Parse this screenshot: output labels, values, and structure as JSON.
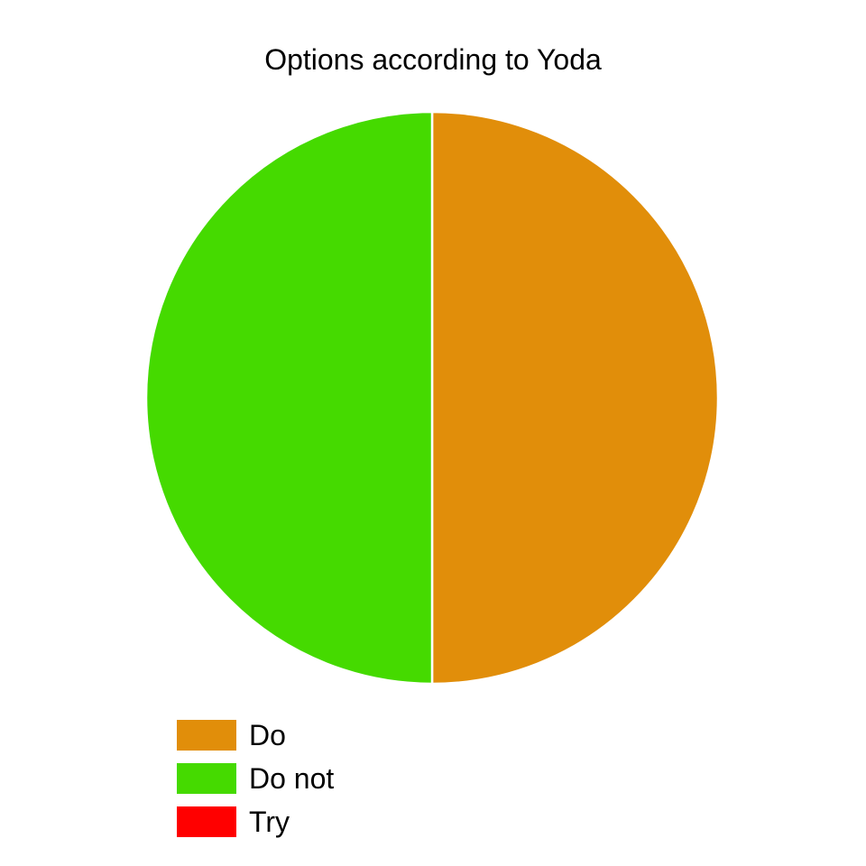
{
  "chart_data": {
    "type": "pie",
    "title": "Options according to Yoda",
    "categories": [
      "Do",
      "Do not",
      "Try"
    ],
    "values": [
      50,
      50,
      0
    ],
    "colors": [
      "#E18E0A",
      "#45DA00",
      "#FF0000"
    ],
    "slice_border_color": "#FFFFFF",
    "legend_position": "bottom-left"
  }
}
